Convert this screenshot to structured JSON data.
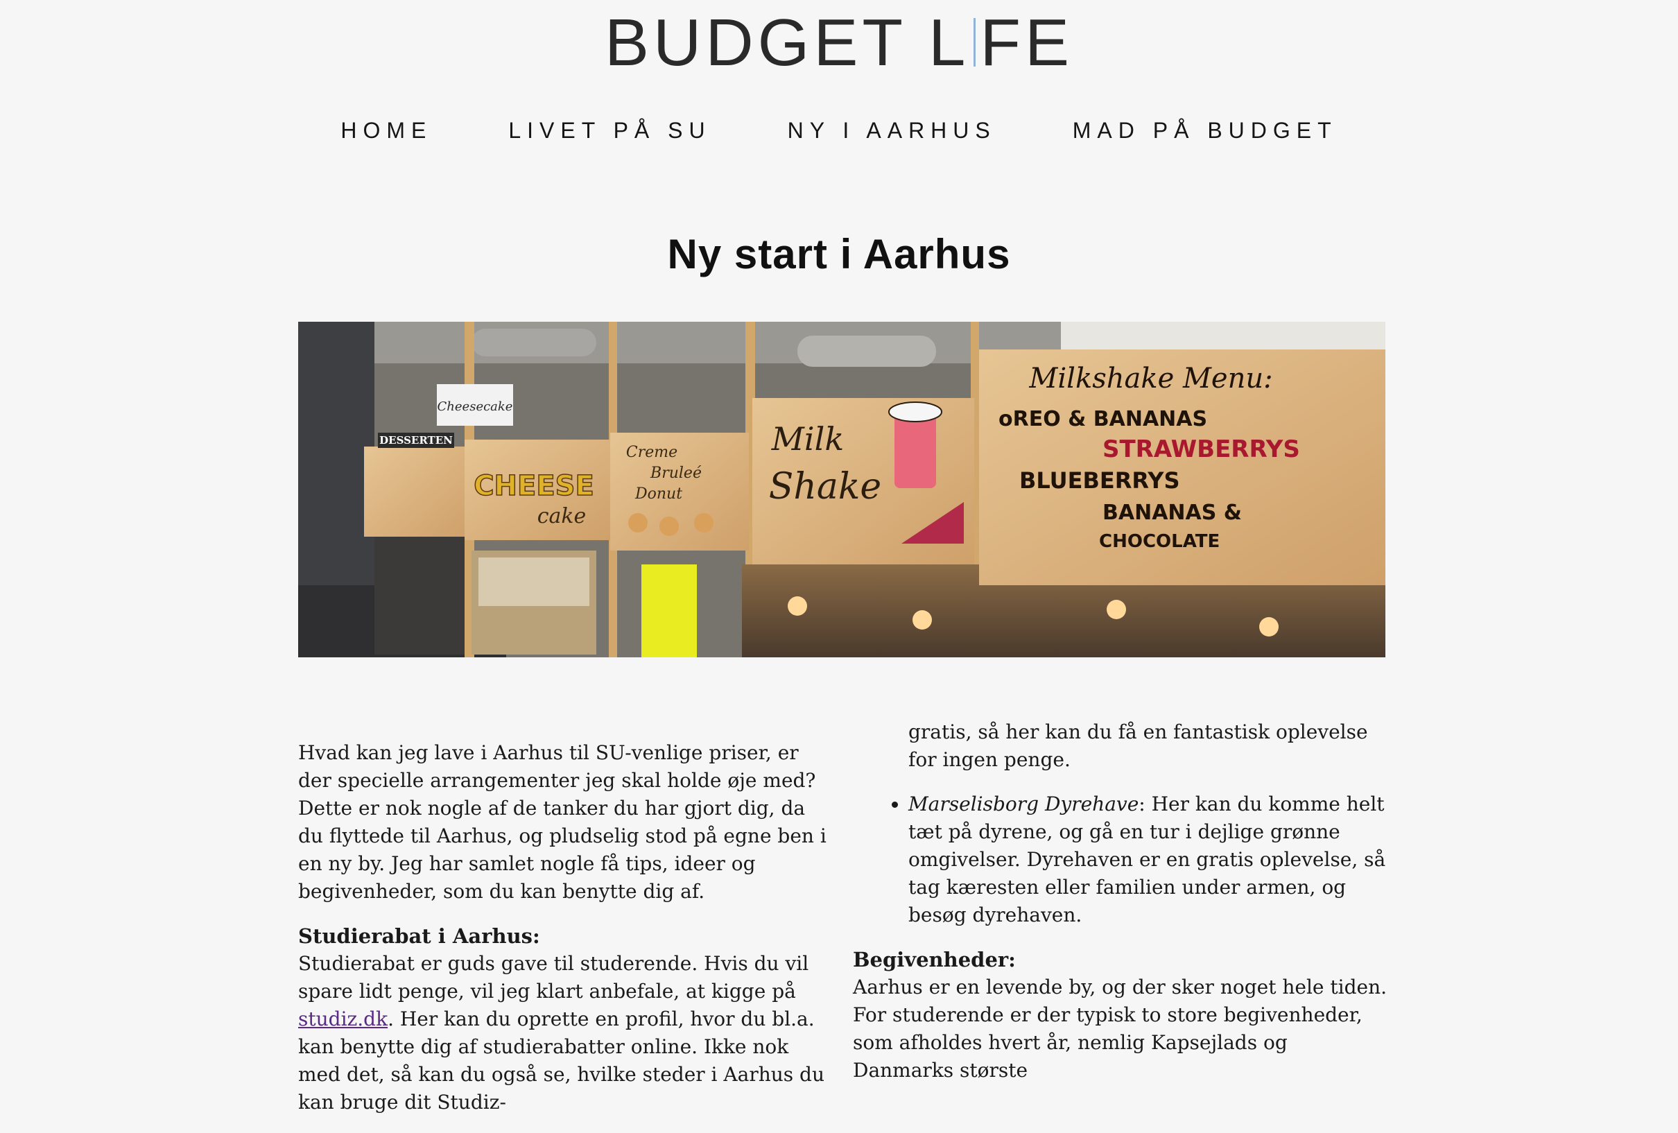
{
  "site": {
    "logo": "BUDGET LIFE",
    "logo_left": "BUDGET L",
    "logo_right": "FE"
  },
  "nav": {
    "items": [
      {
        "label": "HOME"
      },
      {
        "label": "LIVET PÅ SU"
      },
      {
        "label": "NY I AARHUS"
      },
      {
        "label": "MAD PÅ BUDGET"
      }
    ]
  },
  "page": {
    "title": "Ny start i Aarhus"
  },
  "hero": {
    "signs": {
      "desserten": "DESSERTEN",
      "cheesecake": "Cheesecake",
      "cheese": "CHEESE",
      "cake": "cake",
      "creme": "Creme",
      "brulee": "Bruleé",
      "donut": "Donut",
      "milk": "Milk",
      "shake": "Shake",
      "menu_title": "Milkshake Menu:",
      "menu_1": "oREO & BANANAS",
      "menu_2": "STRAWBERRYS",
      "menu_3": "BLUEBERRYS",
      "menu_4": "BANANAS &",
      "menu_5": "CHOCOLATE"
    }
  },
  "content": {
    "intro": "Hvad kan jeg lave i Aarhus til SU-venlige priser, er der specielle arrangementer jeg skal holde øje med? Dette er nok nogle af de tanker du har gjort dig, da du flyttede til Aarhus, og pludselig stod på egne ben i en ny by. Jeg har samlet nogle få tips, ideer og begivenheder, som du kan benytte dig af.",
    "studierabat_heading": "Studierabat i Aarhus:",
    "studierabat_text_before": "Studierabat er guds gave til studerende. Hvis du vil spare lidt penge, vil jeg klart anbefale, at kigge på ",
    "studierabat_link": "studiz.dk",
    "studierabat_text_after": ". Her kan du oprette en profil, hvor du bl.a. kan benytte dig af studierabatter online. Ikke nok med det, så kan du også se, hvilke steder i Aarhus du kan bruge dit Studiz-",
    "col2_continuation": "gratis, så her kan du få en fantastisk oplevelse for ingen penge.",
    "bullet_title": "Marselisborg Dyrehave",
    "bullet_text": ": Her kan du komme helt tæt på dyrene, og gå en tur i dejlige grønne omgivelser. Dyrehaven er en gratis oplevelse, så tag kæresten eller familien under armen, og besøg dyrehaven.",
    "begivenheder_heading": "Begivenheder:",
    "begivenheder_line1": "Aarhus er en levende by, og der sker noget hele tiden.",
    "begivenheder_line2": "For studerende er der typisk to store begivenheder, som afholdes hvert år, nemlig Kapsejlads og Danmarks største"
  },
  "colors": {
    "link": "#5a2a86",
    "background": "#f6f6f6",
    "logo_bar": "#8fb4d6"
  }
}
